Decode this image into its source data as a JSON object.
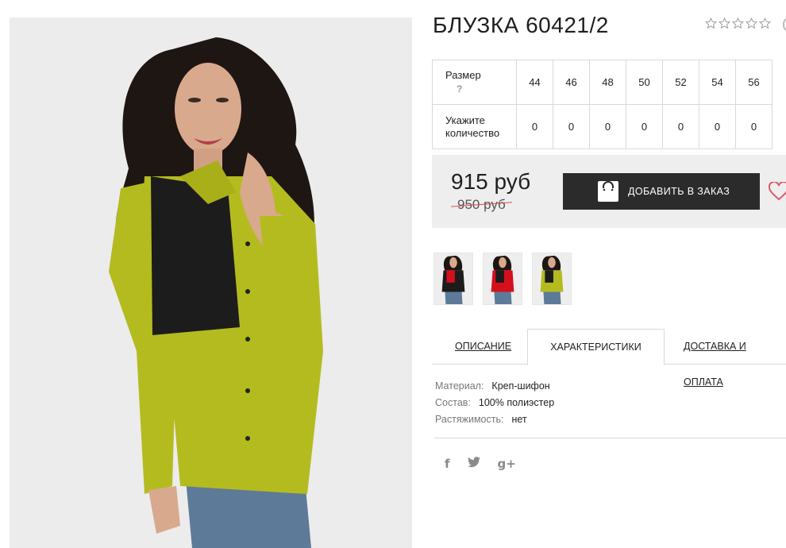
{
  "product": {
    "title": "БЛУЗКА 60421/2",
    "rating": {
      "filled": 0,
      "max": 5
    }
  },
  "sizes": {
    "size_label": "Размер",
    "help_mark": "?",
    "qty_label_line1": "Укажите",
    "qty_label_line2": "количество",
    "values": [
      "44",
      "46",
      "48",
      "50",
      "52",
      "54",
      "56"
    ],
    "quantities": [
      "0",
      "0",
      "0",
      "0",
      "0",
      "0",
      "0"
    ]
  },
  "price": {
    "current": "915 руб",
    "old": "950 руб",
    "add_button": "ДОБАВИТЬ В ЗАКАЗ"
  },
  "thumbnails": [
    {
      "name": "thumb-black-red"
    },
    {
      "name": "thumb-red-black"
    },
    {
      "name": "thumb-olive-black"
    }
  ],
  "tabs": {
    "description": "ОПИСАНИЕ",
    "characteristics": "ХАРАКТЕРИСТИКИ",
    "delivery": "ДОСТАВКА И ОПЛАТА"
  },
  "characteristics": [
    {
      "key": "Материал:",
      "value": "Креп-шифон"
    },
    {
      "key": "Состав:",
      "value": "100% полиэстер"
    },
    {
      "key": "Растяжимость:",
      "value": "нет"
    }
  ],
  "social": {
    "facebook": "f",
    "twitter": "t",
    "gplus": "g+"
  },
  "colors": {
    "olive": "#b4bb1f",
    "black": "#1c1c1c",
    "red": "#d4101c",
    "button": "#2b2b2b",
    "heart": "#d95a6a"
  },
  "icons": [
    "star-icon",
    "bag-icon",
    "heart-icon",
    "facebook-icon",
    "twitter-icon",
    "gplus-icon"
  ]
}
